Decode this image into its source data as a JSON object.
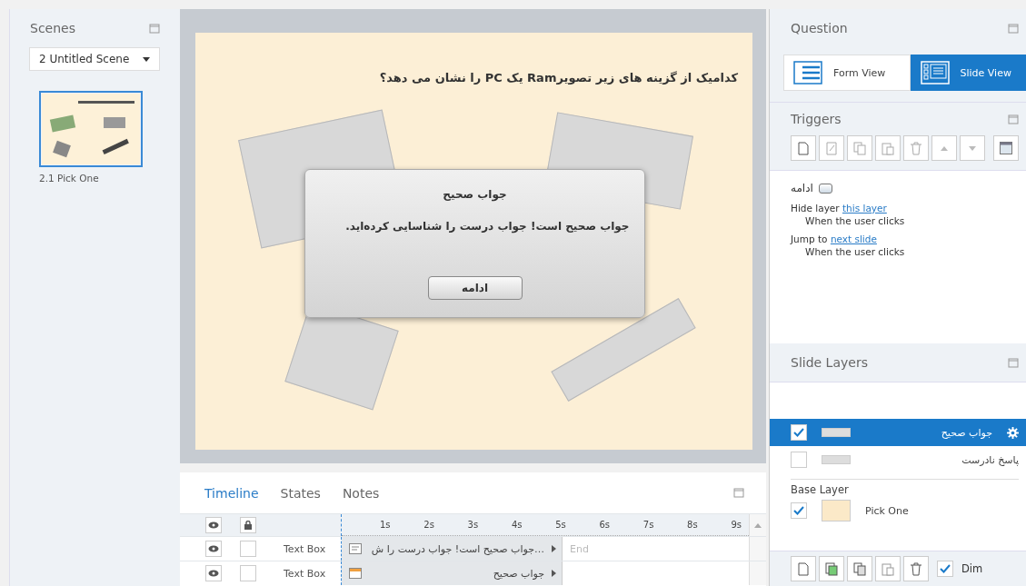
{
  "scenes": {
    "title": "Scenes",
    "dropdown": "2 Untitled Scene",
    "slides": [
      {
        "label": "2.1 Pick One",
        "selected": true
      }
    ]
  },
  "slide": {
    "question": "کدامیک از گزینه های زیر تصویرRam  یک PC  را نشان می دهد؟",
    "dialog": {
      "title": "جواب صحیح",
      "message": "جواب صحیح است!  جواب درست را شناسایی کرده‌اید.",
      "button": "ادامه"
    }
  },
  "timeline": {
    "tabs": [
      {
        "label": "Timeline",
        "selected": true
      },
      {
        "label": "States",
        "selected": false
      },
      {
        "label": "Notes",
        "selected": false
      }
    ],
    "ticks": [
      "1s",
      "2s",
      "3s",
      "4s",
      "5s",
      "6s",
      "7s",
      "8s",
      "9s"
    ],
    "rows": [
      {
        "label": "Text Box",
        "visible": true,
        "locked": false,
        "bar": "…جواب صحیح است! جواب درست را ش",
        "kind": "text"
      },
      {
        "label": "Text Box",
        "visible": true,
        "locked": false,
        "bar": "جواب صحیح",
        "kind": "title"
      }
    ],
    "end_label": "End"
  },
  "question": {
    "title": "Question",
    "views": [
      {
        "label": "Form View",
        "kind": "form",
        "selected": false
      },
      {
        "label": "Slide View",
        "kind": "slide",
        "selected": true
      }
    ]
  },
  "triggers": {
    "title": "Triggers",
    "object": "ادامه",
    "actions": [
      {
        "action": "Hide layer",
        "target": "this layer",
        "condition": "When the user clicks"
      },
      {
        "action": "Jump to",
        "target": "next slide",
        "condition": "When the user clicks"
      }
    ]
  },
  "layers": {
    "title": "Slide Layers",
    "items": [
      {
        "name": "جواب صحیح",
        "checked": true,
        "selected": true
      },
      {
        "name": "پاسخ نادرست",
        "checked": false,
        "selected": false
      }
    ],
    "base_title": "Base Layer",
    "base": {
      "name": "Pick One",
      "checked": true
    },
    "dim": {
      "label": "Dim",
      "checked": true
    }
  }
}
